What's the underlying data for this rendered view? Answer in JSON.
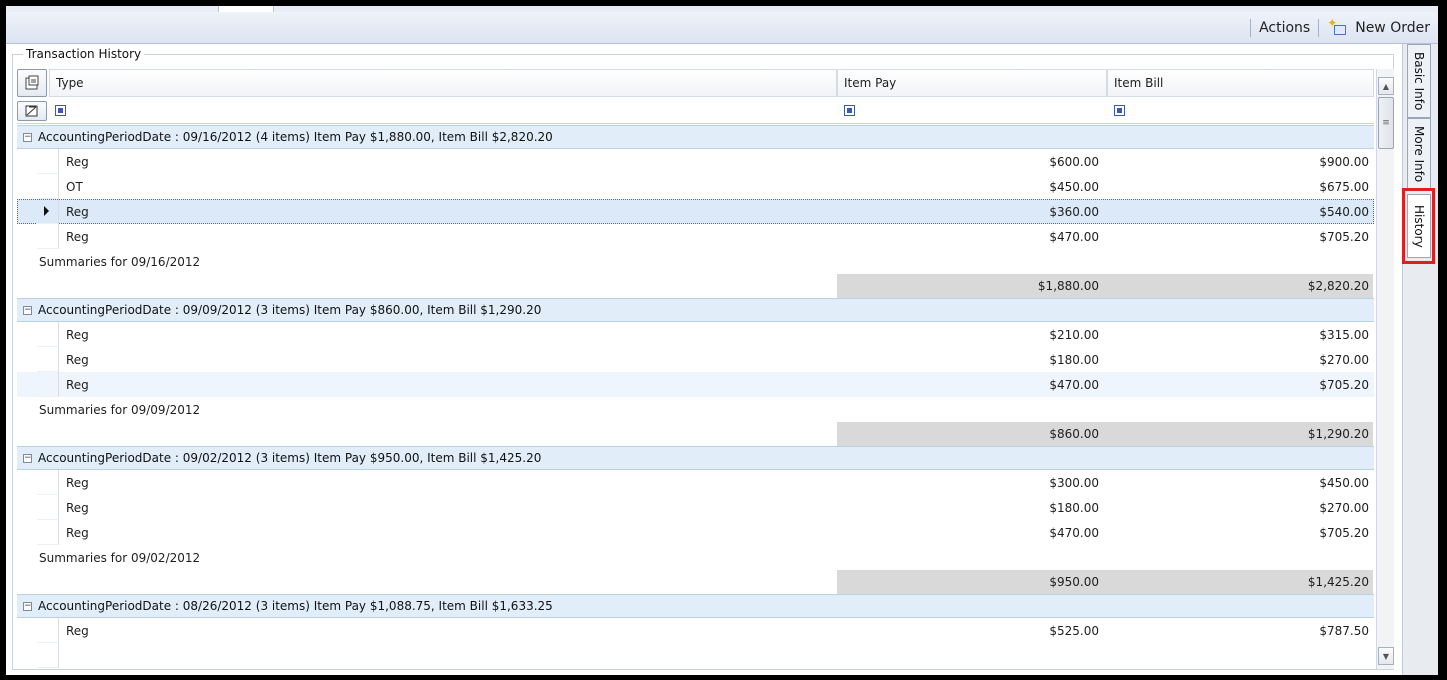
{
  "toolbar": {
    "actions_label": "Actions",
    "new_order_label": "New Order"
  },
  "side_tabs": [
    {
      "label": "Basic Info"
    },
    {
      "label": "More Info"
    },
    {
      "label": "History",
      "selected": true
    }
  ],
  "groupbox_title": "Transaction History",
  "grid": {
    "columns": [
      "Type",
      "Item Pay",
      "Item Bill"
    ],
    "groups": [
      {
        "header": "AccountingPeriodDate : 09/16/2012 (4 items) Item Pay $1,880.00, Item Bill $2,820.20",
        "rows": [
          {
            "type": "Reg",
            "pay": "$600.00",
            "bill": "$900.00"
          },
          {
            "type": "OT",
            "pay": "$450.00",
            "bill": "$675.00"
          },
          {
            "type": "Reg",
            "pay": "$360.00",
            "bill": "$540.00",
            "selected": true
          },
          {
            "type": "Reg",
            "pay": "$470.00",
            "bill": "$705.20"
          }
        ],
        "summary_label": "Summaries for 09/16/2012",
        "summary_pay": "$1,880.00",
        "summary_bill": "$2,820.20"
      },
      {
        "header": "AccountingPeriodDate : 09/09/2012 (3 items) Item Pay $860.00, Item Bill $1,290.20",
        "rows": [
          {
            "type": "Reg",
            "pay": "$210.00",
            "bill": "$315.00"
          },
          {
            "type": "Reg",
            "pay": "$180.00",
            "bill": "$270.00"
          },
          {
            "type": "Reg",
            "pay": "$470.00",
            "bill": "$705.20",
            "alt": true
          }
        ],
        "summary_label": "Summaries for 09/09/2012",
        "summary_pay": "$860.00",
        "summary_bill": "$1,290.20"
      },
      {
        "header": "AccountingPeriodDate : 09/02/2012 (3 items) Item Pay $950.00, Item Bill $1,425.20",
        "rows": [
          {
            "type": "Reg",
            "pay": "$300.00",
            "bill": "$450.00"
          },
          {
            "type": "Reg",
            "pay": "$180.00",
            "bill": "$270.00"
          },
          {
            "type": "Reg",
            "pay": "$470.00",
            "bill": "$705.20"
          }
        ],
        "summary_label": "Summaries for 09/02/2012",
        "summary_pay": "$950.00",
        "summary_bill": "$1,425.20"
      },
      {
        "header": "AccountingPeriodDate : 08/26/2012 (3 items) Item Pay $1,088.75, Item Bill $1,633.25",
        "rows": [
          {
            "type": "Reg",
            "pay": "$525.00",
            "bill": "$787.50"
          }
        ]
      }
    ]
  },
  "colors": {
    "group_header_bg": "#e1eef9",
    "summary_bg": "#d9d9d9",
    "highlight": "#e02020"
  }
}
